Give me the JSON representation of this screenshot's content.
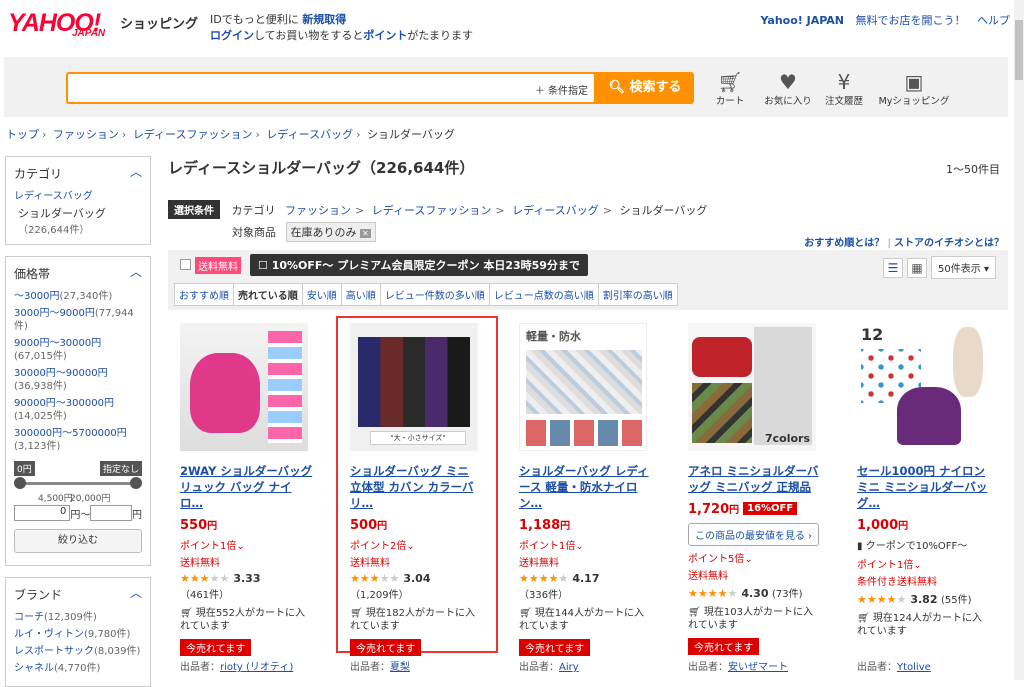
{
  "header": {
    "logo": "YAHOO!",
    "logo_sub": "JAPAN",
    "shopping": "ショッピング",
    "msg_line1_pre": "IDでもっと便利に",
    "msg_line1_link": "新規取得",
    "msg_line2_link1": "ログイン",
    "msg_line2_mid": "してお買い物をすると",
    "msg_line2_link2": "ポイント",
    "msg_line2_post": "がたまります",
    "right_links": [
      "Yahoo! JAPAN",
      "無料でお店を開こう！",
      "ヘルプ"
    ]
  },
  "search": {
    "value": "",
    "cond_label": "＋ 条件指定",
    "button": "検索する",
    "nav": [
      {
        "icon": "cart-icon",
        "glyph": "🛒",
        "label": "カート"
      },
      {
        "icon": "heart-icon",
        "glyph": "♥",
        "label": "お気に入り"
      },
      {
        "icon": "yen-icon",
        "glyph": "¥",
        "label": "注文履歴"
      },
      {
        "icon": "person-icon",
        "glyph": "👤",
        "label": "Myショッピング"
      }
    ]
  },
  "breadcrumb": [
    "トップ",
    "ファッション",
    "レディースファッション",
    "レディースバッグ",
    "ショルダーバッグ"
  ],
  "sidebar": {
    "category": {
      "title": "カテゴリ",
      "parent": "レディースバッグ",
      "current": "ショルダーバッグ",
      "current_count": "（226,644件）"
    },
    "price": {
      "title": "価格帯",
      "items": [
        {
          "label": "〜3000円",
          "count": "(27,340件)"
        },
        {
          "label": "3000円〜9000円",
          "count": "(77,944件)"
        },
        {
          "label": "9000円〜30000円",
          "count": "(67,015件)"
        },
        {
          "label": "30000円〜90000円",
          "count": "(36,938件)"
        },
        {
          "label": "90000円〜300000円",
          "count": "(14,025件)"
        },
        {
          "label": "300000円〜5700000円",
          "count": "(3,123件)"
        }
      ],
      "slider_min": "0円",
      "slider_max": "指定なし",
      "tick1": "4,500円",
      "tick2": "20,000円",
      "input_min": "0",
      "unit_mid": "円〜",
      "unit_end": "円",
      "button": "絞り込む"
    },
    "brand": {
      "title": "ブランド",
      "items": [
        {
          "label": "コーチ",
          "count": "(12,309件)"
        },
        {
          "label": "ルイ・ヴィトン",
          "count": "(9,780件)"
        },
        {
          "label": "レスポートサック",
          "count": "(8,039件)"
        },
        {
          "label": "シャネル",
          "count": "(4,770件)"
        }
      ]
    }
  },
  "main": {
    "title": "レディースショルダーバッグ（226,644件）",
    "range": "1〜50件目",
    "cond_tag": "選択条件",
    "cond_label": "カテゴリ",
    "cond_path": [
      "ファッション",
      "レディースファッション",
      "レディースバッグ",
      "ショルダーバッグ"
    ],
    "target_label": "対象商品",
    "target_chip": "在庫ありのみ",
    "help1": "おすすめ順とは？",
    "help2": "ストアのイチオシとは？",
    "free_badge": "送料無料",
    "coupon_banner": "10%OFF〜 プレミアム会員限定クーポン 本日23時59分まで",
    "sorts": [
      "おすすめ順",
      "売れている順",
      "安い順",
      "高い順",
      "レビュー件数の多い順",
      "レビュー点数の高い順",
      "割引率の高い順"
    ],
    "per_page": "50件表示"
  },
  "products": [
    {
      "name": "2WAY ショルダーバッグ リュック バッグ ナイロ…",
      "price": "550",
      "yen": "円",
      "point": "ポイント1倍",
      "free": "送料無料",
      "rating": "3.33",
      "reviews": "（461件）",
      "cart": "現在552人がカートに入れています",
      "now": "今売れてます",
      "seller_label": "出品者：",
      "seller": "rioty (リオティ)",
      "img_color": "#e0388a"
    },
    {
      "name": "ショルダーバッグ ミニ 立体型 カバン カラーバリ…",
      "price": "500",
      "yen": "円",
      "point": "ポイント2倍",
      "free": "送料無料",
      "rating": "3.04",
      "reviews": "（1,209件）",
      "cart": "現在182人がカートに入れています",
      "now": "今売れてます",
      "seller_label": "出品者：",
      "seller": "夏梨",
      "img_color": "#2a2a3a"
    },
    {
      "name": "ショルダーバッグ レディース 軽量・防水ナイロン…",
      "price": "1,188",
      "yen": "円",
      "point": "ポイント1倍",
      "free": "送料無料",
      "rating": "4.17",
      "reviews": "（336件）",
      "cart": "現在144人がカートに入れています",
      "now": "今売れてます",
      "seller_label": "出品者：",
      "seller": "Airy",
      "img_color": "#c8c8c8"
    },
    {
      "name": "アネロ ミニショルダーバッグ ミニバッグ 正規品",
      "price": "1,720",
      "yen": "円",
      "off": "16%OFF",
      "lowest_btn": "この商品の最安値を見る ›",
      "point": "ポイント5倍",
      "free": "送料無料",
      "rating": "4.30",
      "reviews": "(73件)",
      "cart": "現在103人がカートに入れています",
      "now": "今売れてます",
      "seller_label": "出品者：",
      "seller": "安いぜマート",
      "img_color": "#c0242a"
    },
    {
      "name": "セール1000円 ナイロンミニ ミニショルダーバッグ…",
      "price": "1,000",
      "yen": "円",
      "coupon": "クーポンで10%OFF〜",
      "point": "ポイント1倍",
      "free": "条件付き送料無料",
      "rating": "3.82",
      "reviews": "(55件)",
      "cart": "現在124人がカートに入れています",
      "seller_label": "出品者：",
      "seller": "Ytolive",
      "img_color": "#6a2a7a"
    }
  ]
}
